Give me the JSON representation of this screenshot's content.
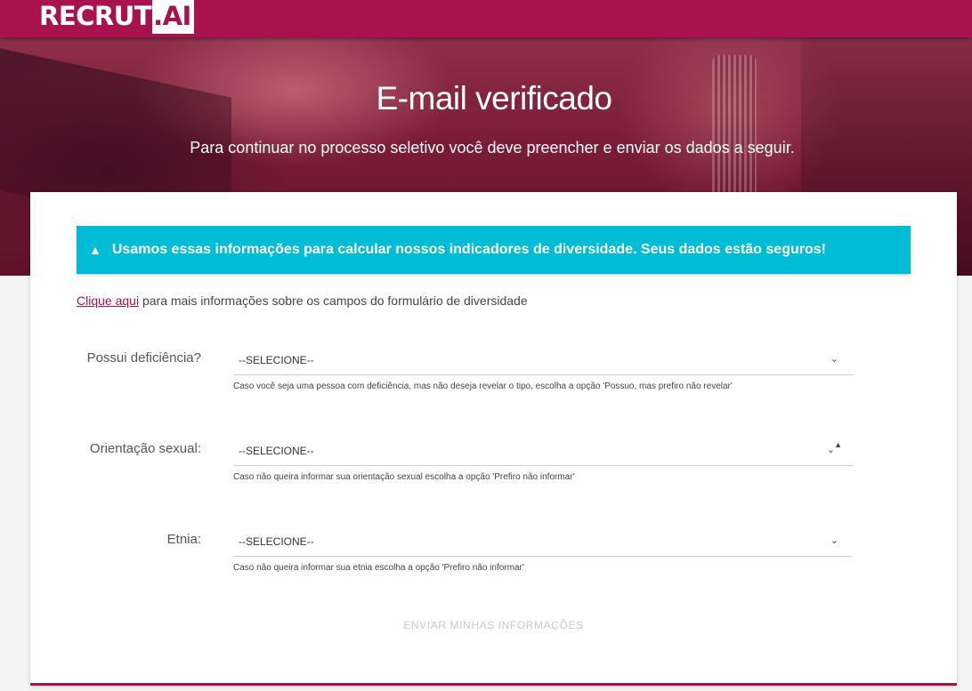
{
  "header": {
    "logo_text": "RECRUT",
    "logo_box": ".AI"
  },
  "hero": {
    "title": "E-mail verificado",
    "subtitle": "Para continuar no processo seletivo você deve preencher e enviar os dados a seguir."
  },
  "alert": {
    "icon": "warning-icon",
    "text": "Usamos essas informações para calcular nossos indicadores de diversidade. Seus dados estão seguros!",
    "color": "#00bcd4"
  },
  "info": {
    "link_text": "Clique aqui",
    "rest_text": "para mais informações sobre os campos do formulário de diversidade"
  },
  "fields": [
    {
      "label": "Possui deficiência?",
      "value": "--SELECIONE--",
      "hint": "Caso você seja uma pessoa com deficiência, mas não deseja revelar o tipo, escolha a opção 'Possuo, mas prefiro não revelar'"
    },
    {
      "label": "Orientação sexual:",
      "value": "--SELECIONE--",
      "hint": "Caso não queira informar sua orientação sexual escolha a opção 'Prefiro não informar'"
    },
    {
      "label": "Etnia:",
      "value": "--SELECIONE--",
      "hint": "Caso não queira informar sua etnia escolha a opção 'Prefiro não informar'"
    }
  ],
  "submit_label": "ENVIAR MINHAS INFORMAÇÕES",
  "colors": {
    "brand": "#a8124f",
    "alert": "#00bcd4"
  }
}
